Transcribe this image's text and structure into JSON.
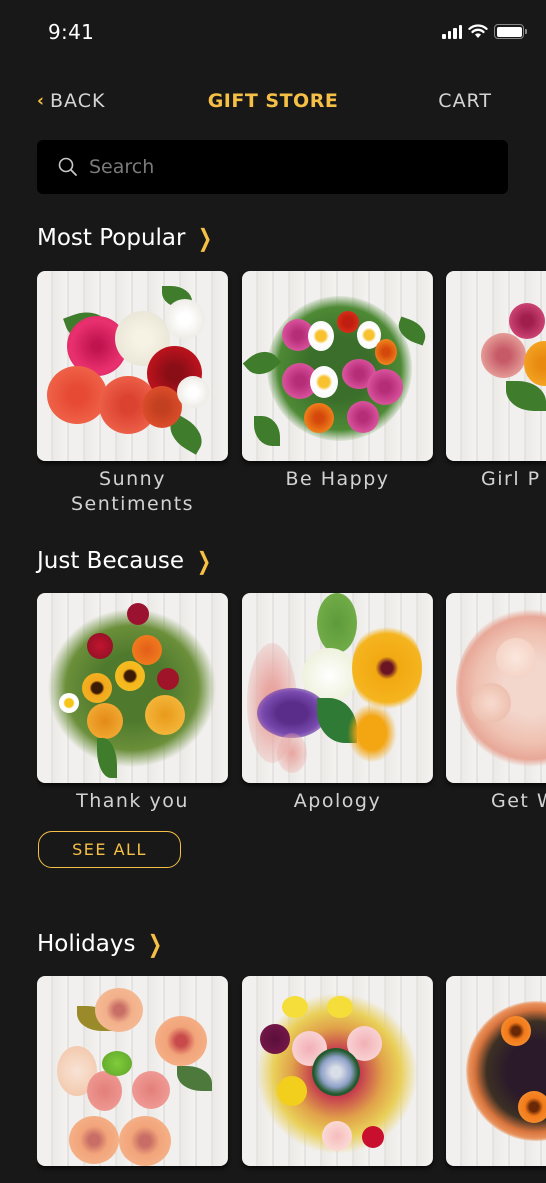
{
  "status_bar": {
    "time": "9:41",
    "icons": [
      "cellular-signal-icon",
      "wifi-icon",
      "battery-icon"
    ]
  },
  "nav": {
    "back_icon": "chevron-left-icon",
    "back_label": "BACK",
    "title": "GIFT STORE",
    "cart_label": "CART"
  },
  "search": {
    "icon": "search-icon",
    "placeholder": "Search",
    "value": ""
  },
  "colors": {
    "background": "#181818",
    "accent": "#f5c045",
    "label_text": "#d2d2d2",
    "search_bg": "#000000"
  },
  "sections": [
    {
      "title": "Most Popular",
      "chevron": "chevron-right-icon",
      "items": [
        {
          "name": "Sunny\nSentiments",
          "image": "bouquet-roses-pink-white-red"
        },
        {
          "name": "Be Happy",
          "image": "bouquet-pink-roses-white-tulips"
        },
        {
          "name": "Girl P",
          "image": "bouquet-ranunculus"
        }
      ]
    },
    {
      "title": "Just Because",
      "chevron": "chevron-right-icon",
      "items": [
        {
          "name": "Thank you",
          "image": "bouquet-sunflowers-autumn"
        },
        {
          "name": "Apology",
          "image": "bouquet-black-eyed-susan-snapdragon"
        },
        {
          "name": "Get W",
          "image": "bouquet-blush-roses"
        }
      ],
      "see_all_label": "SEE ALL"
    },
    {
      "title": "Holidays",
      "chevron": "chevron-right-icon",
      "items": [
        {
          "name": "",
          "image": "bouquet-peach-peonies"
        },
        {
          "name": "",
          "image": "bouquet-mixed-succulent"
        },
        {
          "name": "",
          "image": "bouquet-orange-gerbera-wrapped"
        }
      ]
    }
  ]
}
